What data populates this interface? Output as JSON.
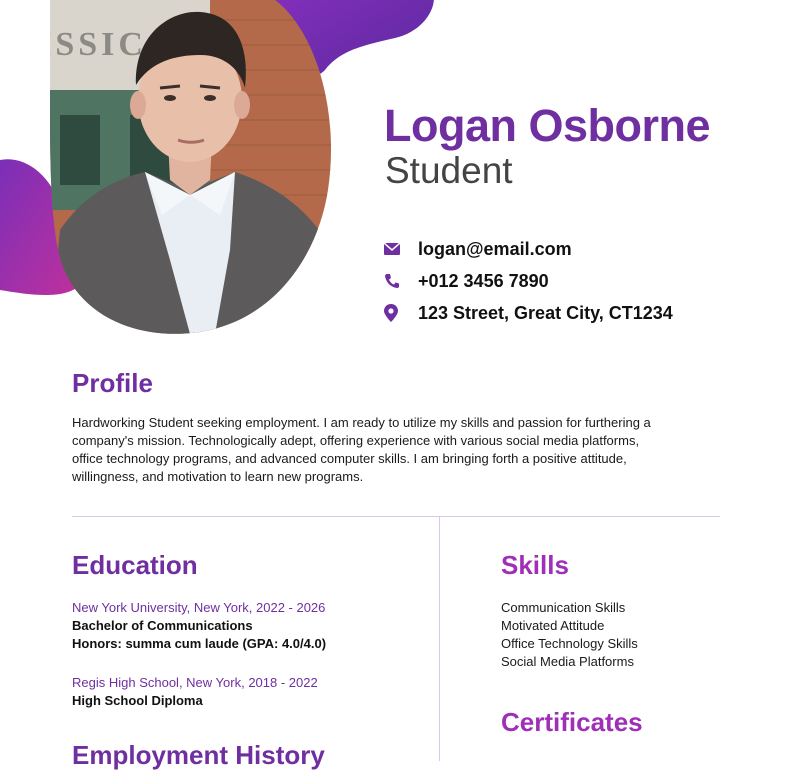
{
  "header": {
    "name": "Logan Osborne",
    "title": "Student"
  },
  "contact": [
    {
      "icon": "envelope-icon",
      "text": "logan@email.com"
    },
    {
      "icon": "phone-icon",
      "text": "+012 3456 7890"
    },
    {
      "icon": "location-pin-icon",
      "text": "123 Street, Great City, CT1234"
    }
  ],
  "photo": {
    "sign_text": "MISSIC"
  },
  "profile": {
    "heading": "Profile",
    "lines": [
      "Hardworking Student seeking employment. I am ready to utilize my skills and passion for furthering a",
      "company's mission. Technologically adept, offering experience with various social media platforms,",
      "office technology programs, and advanced computer skills. I am bringing forth a positive attitude,",
      "willingness, and motivation to learn new programs."
    ]
  },
  "education": {
    "heading": "Education",
    "entries": [
      {
        "school": "New York University, New York, 2022 - 2026",
        "degree": "Bachelor of Communications",
        "honors": "Honors: summa cum laude (GPA: 4.0/4.0)"
      },
      {
        "school": "Regis High School, New York, 2018 - 2022",
        "degree": "High School Diploma"
      }
    ]
  },
  "employment": {
    "heading": "Employment History"
  },
  "skills": {
    "heading": "Skills",
    "items": [
      "Communication Skills",
      "Motivated Attitude",
      "Office Technology Skills",
      "Social Media Platforms"
    ]
  },
  "certificates": {
    "heading": "Certificates"
  },
  "colors": {
    "accent": "#6f2fa0",
    "accent_magenta": "#c12fb0",
    "divider": "#d8c8ec"
  }
}
